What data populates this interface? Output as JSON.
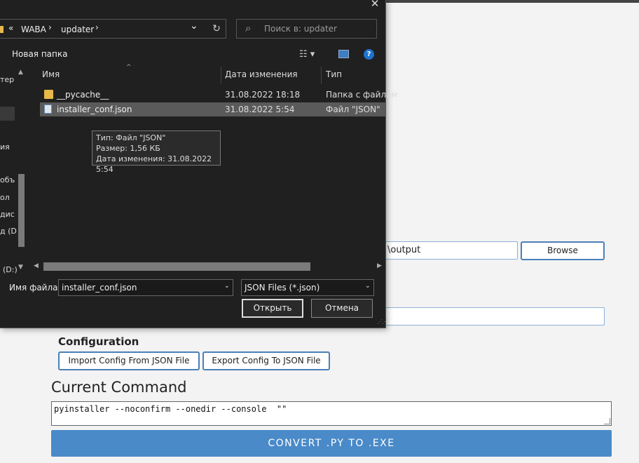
{
  "background_app": {
    "output_path": "\\output",
    "browse_label": "Browse",
    "configuration_title": "Configuration",
    "import_label": "Import Config From JSON File",
    "export_label": "Export Config To JSON File",
    "current_command_title": "Current Command",
    "command": "pyinstaller --noconfirm --onedir --console  \"\"",
    "convert_label": "CONVERT .PY TO .EXE"
  },
  "dialog": {
    "close": "✕",
    "breadcrumb": {
      "chevron_left": "«",
      "folder1": "WABA",
      "sep1": "›",
      "folder2": "updater",
      "sep2": "›",
      "dropdown": "⌄"
    },
    "refresh": "↻",
    "search_placeholder": "Поиск в: updater",
    "search_icon": "⌕",
    "new_folder": "Новая папка",
    "view_icon": "☷ ▾",
    "help": "?",
    "nav_items": [
      "тер",
      "ия",
      "объ",
      "ол",
      "дис",
      "д (D",
      "(D:)"
    ],
    "columns": {
      "name": "Имя",
      "date": "Дата изменения",
      "type": "Тип"
    },
    "files": [
      {
        "name": "__pycache__",
        "date": "31.08.2022 18:18",
        "type": "Папка с файлам",
        "icon": "folder-icon"
      },
      {
        "name": "installer_conf.json",
        "date": "31.08.2022 5:54",
        "type": "Файл \"JSON\"",
        "icon": "json-file-icon"
      }
    ],
    "tooltip": {
      "type": "Тип: Файл \"JSON\"",
      "size": "Размер: 1,56 КБ",
      "modified": "Дата изменения: 31.08.2022 5:54"
    },
    "filename_label": "Имя файла:",
    "filename_value": "installer_conf.json",
    "filter_value": "JSON Files (*.json)",
    "open_label": "Открыть",
    "cancel_label": "Отмена"
  }
}
